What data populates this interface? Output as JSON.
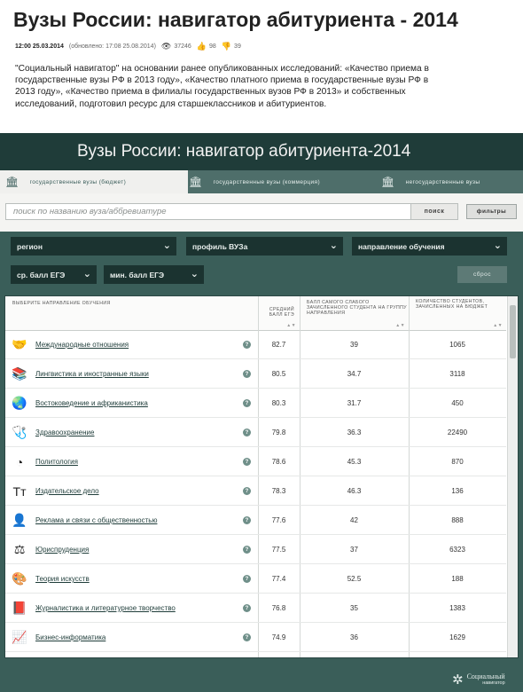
{
  "article": {
    "title": "Вузы России: навигатор абитуриента - 2014",
    "published": "12:00 25.03.2014",
    "updated": "(обновлено: 17:08 25.08.2014)",
    "views": "37246",
    "likes": "98",
    "dislikes": "39",
    "intro": "\"Социальный навигатор\" на основании ранее опубликованных исследований: «Качество приема в государственные вузы РФ в 2013 году», «Качество платного приема в государственные вузы РФ в 2013 году», «Качество приема в филиалы государственных вузов РФ в 2013» и собственных исследований, подготовил ресурс для старшеклассников и абитуриентов."
  },
  "app": {
    "title": "Вузы России: навигатор абитуриента-2014",
    "tabs": [
      {
        "label": "государственные вузы (бюджет)",
        "icon": "university-icon",
        "active": true
      },
      {
        "label": "государственные вузы (коммерция)",
        "icon": "university-icon",
        "active": false
      },
      {
        "label": "негосударственные вузы",
        "icon": "university-icon",
        "active": false
      }
    ],
    "search": {
      "placeholder": "поиск по названию вуза/аббревиатуре",
      "button": "поиск",
      "filters": "фильтры"
    },
    "filters": {
      "region": "регион",
      "profile": "профиль ВУЗа",
      "direction": "направление обучения",
      "avg_score": "ср. балл ЕГЭ",
      "min_score": "мин. балл ЕГЭ",
      "reset": "сброс"
    },
    "table": {
      "headers": {
        "name": "выберите направление обучения",
        "avg": "средний балл егэ",
        "min": "балл самого слабого зачисленного студента на группу направления",
        "count": "количество студентов, зачисленных на бюджет"
      },
      "rows": [
        {
          "icon": "handshake-icon",
          "glyph": "🤝",
          "name": "Международные отношения",
          "avg": "82.7",
          "min": "39",
          "count": "1065"
        },
        {
          "icon": "books-icon",
          "glyph": "📚",
          "name": "Лингвистика и иностранные языки",
          "avg": "80.5",
          "min": "34.7",
          "count": "3118"
        },
        {
          "icon": "globe-icon",
          "glyph": "🌏",
          "name": "Востоковедение и африканистика",
          "avg": "80.3",
          "min": "31.7",
          "count": "450"
        },
        {
          "icon": "first-aid-icon",
          "glyph": "🩺",
          "name": "Здравоохранение",
          "avg": "79.8",
          "min": "36.3",
          "count": "22490"
        },
        {
          "icon": "pie-chart-icon",
          "glyph": "◔",
          "name": "Политология",
          "avg": "78.6",
          "min": "45.3",
          "count": "870"
        },
        {
          "icon": "typography-icon",
          "glyph": "Tт",
          "name": "Издательское дело",
          "avg": "78.3",
          "min": "46.3",
          "count": "136"
        },
        {
          "icon": "person-icon",
          "glyph": "👤",
          "name": "Реклама и связи с общественностью",
          "avg": "77.6",
          "min": "42",
          "count": "888"
        },
        {
          "icon": "scales-icon",
          "glyph": "⚖",
          "name": "Юриспруденция",
          "avg": "77.5",
          "min": "37",
          "count": "6323"
        },
        {
          "icon": "palette-icon",
          "glyph": "🎨",
          "name": "Теория искусств",
          "avg": "77.4",
          "min": "52.5",
          "count": "188"
        },
        {
          "icon": "notebook-icon",
          "glyph": "📕",
          "name": "Журналистика и литературное творчество",
          "avg": "76.8",
          "min": "35",
          "count": "1383"
        },
        {
          "icon": "line-chart-icon",
          "glyph": "📈",
          "name": "Бизнес-информатика",
          "avg": "74.9",
          "min": "36",
          "count": "1629"
        }
      ]
    },
    "footer": {
      "logo_line1": "Социальный",
      "logo_line2": "навигатор"
    }
  }
}
